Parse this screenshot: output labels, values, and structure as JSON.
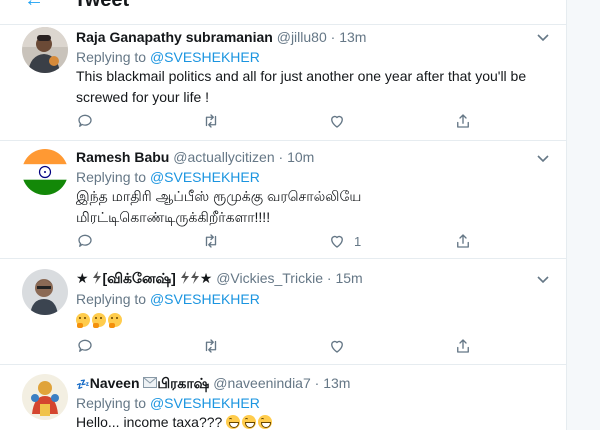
{
  "header": {
    "back_glyph": "←",
    "title": "Tweet"
  },
  "tweets": [
    {
      "name": "Raja Ganapathy subramanian",
      "handle": "@jillu80",
      "sep": "·",
      "time": "13m",
      "replying_prefix": "Replying to",
      "replying_to": "@SVESHEKHER",
      "text": "This blackmail politics and all for just another one year after that you'll be screwed for your life !",
      "like_count": ""
    },
    {
      "name": "Ramesh Babu",
      "handle": "@actuallycitizen",
      "sep": "·",
      "time": "10m",
      "replying_prefix": "Replying to",
      "replying_to": "@SVESHEKHER",
      "text": "இந்த மாதிரி ஆப்பீஸ் ரூமுக்கு வரசொல்லியே மிரட்டிகொண்டிருக்கிறீர்களா!!!!",
      "like_count": "1"
    },
    {
      "name_prefix": "★",
      "name_main": "[விக்னேஷ்]",
      "name_suffix": "★",
      "handle": "@Vickies_Trickie",
      "sep": "·",
      "time": "15m",
      "replying_prefix": "Replying to",
      "replying_to": "@SVESHEKHER",
      "like_count": ""
    },
    {
      "name_prefix": "💤",
      "name_a": "Naveen",
      "name_b": "பிரகாஷ்",
      "handle": "@naveenindia7",
      "sep": "·",
      "time": "13m",
      "replying_prefix": "Replying to",
      "replying_to": "@SVESHEKHER",
      "text": "Hello... income taxa???"
    }
  ],
  "colors": {
    "accent": "#1da1f2",
    "mention": "#1b95e0",
    "muted": "#657786",
    "border": "#e6ecf0"
  },
  "icons": [
    "reply-icon",
    "retweet-icon",
    "like-icon",
    "share-icon",
    "chevron-down-icon"
  ]
}
